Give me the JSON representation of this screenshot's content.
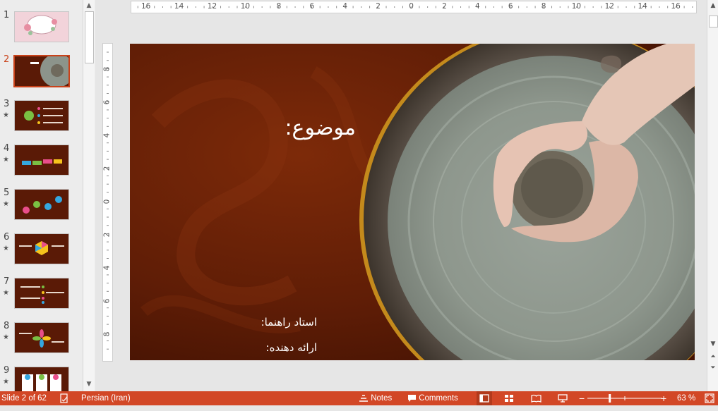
{
  "thumbnails": [
    {
      "num": "1",
      "star": ""
    },
    {
      "num": "2",
      "star": ""
    },
    {
      "num": "3",
      "star": "★"
    },
    {
      "num": "4",
      "star": "★"
    },
    {
      "num": "5",
      "star": "★"
    },
    {
      "num": "6",
      "star": "★"
    },
    {
      "num": "7",
      "star": "★"
    },
    {
      "num": "8",
      "star": "★"
    },
    {
      "num": "9",
      "star": "★"
    }
  ],
  "ruler_h_labels": [
    "16",
    "14",
    "12",
    "10",
    "8",
    "6",
    "4",
    "2",
    "0",
    "2",
    "4",
    "6",
    "8",
    "10",
    "12",
    "14",
    "16"
  ],
  "ruler_v_labels": [
    "8",
    "6",
    "4",
    "2",
    "0",
    "2",
    "4",
    "6",
    "8"
  ],
  "slide": {
    "title": "موضوع:",
    "advisor": "استاد راهنما:",
    "presenter": "ارائه دهنده:"
  },
  "status": {
    "slide_info": "Slide 2 of 62",
    "language": "Persian (Iran)",
    "notes_label": "Notes",
    "comments_label": "Comments",
    "zoom_minus": "−",
    "zoom_plus": "+",
    "zoom_value": "63 %",
    "zoom_level": 0.63
  },
  "colors": {
    "accent": "#d24726",
    "slide_bg": "#5b1a06"
  }
}
